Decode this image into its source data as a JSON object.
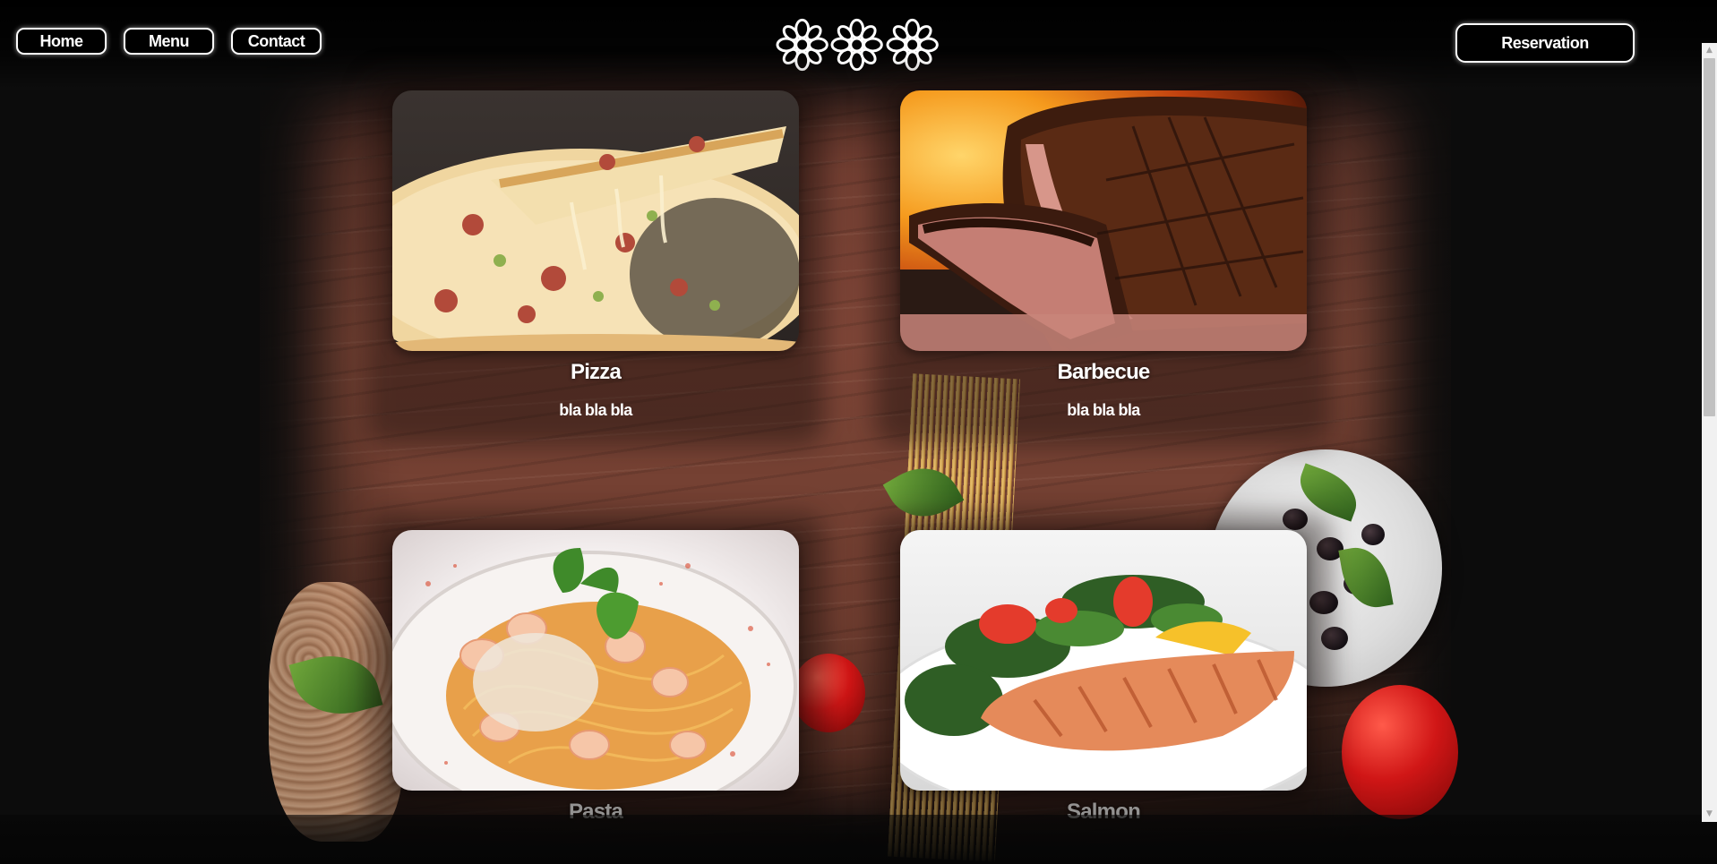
{
  "nav": {
    "home_label": "Home",
    "menu_label": "Menu",
    "contact_label": "Contact",
    "reservation_label": "Reservation",
    "logo_icon": "flower-icon"
  },
  "menu": {
    "items": [
      {
        "title": "Pizza",
        "description": "bla bla bla",
        "image_icon": "pizza-image"
      },
      {
        "title": "Barbecue",
        "description": "bla bla bla",
        "image_icon": "barbecue-image"
      },
      {
        "title": "Pasta",
        "image_icon": "pasta-image"
      },
      {
        "title": "Salmon",
        "image_icon": "salmon-image"
      }
    ]
  },
  "colors": {
    "background": "#0b0b0b",
    "button_fill": "#000000",
    "button_border": "#ffffff",
    "text": "#ffffff"
  }
}
